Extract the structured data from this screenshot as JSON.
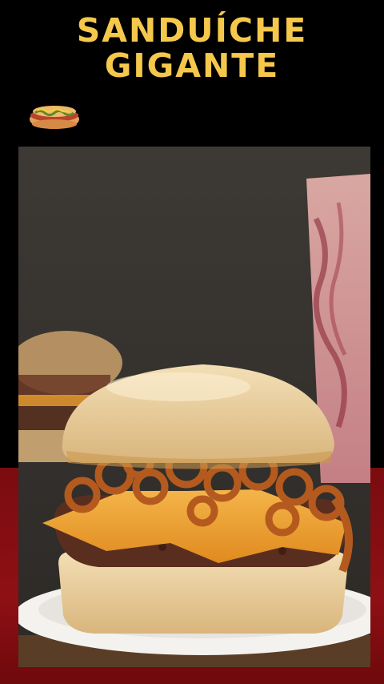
{
  "title": {
    "line1": "SANDUÍCHE",
    "line2": "GIGANTE"
  },
  "icons": {
    "decoration": "hotdog-icon"
  },
  "colors": {
    "title": "#f5c84c",
    "background": "#000000",
    "accent_red": "#8e1014"
  }
}
